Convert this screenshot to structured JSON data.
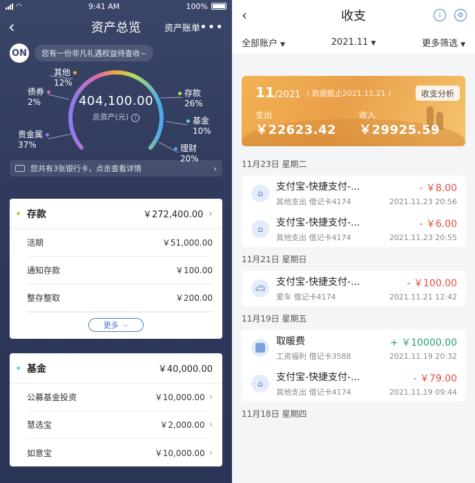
{
  "left": {
    "status": {
      "time": "9:41 AM",
      "battery": "100%"
    },
    "nav": {
      "title": "资产总览",
      "account_link": "资产账单",
      "more": "•••",
      "back": "‹"
    },
    "promo": {
      "text": "您有一份非凡礼遇权益待查收~",
      "mascot": "ON"
    },
    "gauge": {
      "total": "404,100.00",
      "subtitle": "总资产(元)",
      "info": "i",
      "categories": [
        {
          "name": "其他",
          "pct": "12%",
          "color": "#f3a73e"
        },
        {
          "name": "债券",
          "pct": "2%",
          "color": "#e06aa8"
        },
        {
          "name": "贵金属",
          "pct": "37%",
          "color": "#8a7cf0"
        },
        {
          "name": "存款",
          "pct": "26%",
          "color": "#b8e05a"
        },
        {
          "name": "基金",
          "pct": "10%",
          "color": "#5fd7e0"
        },
        {
          "name": "理财",
          "pct": "20%",
          "color": "#4aa6f0"
        }
      ]
    },
    "cards_bar": "您共有3张银行卡，点击查看详情",
    "deposit": {
      "title": "存款",
      "amount": "￥272,400.00",
      "dot": "#b8d34a",
      "rows": [
        {
          "label": "活期",
          "amount": "￥51,000.00"
        },
        {
          "label": "通知存款",
          "amount": "￥100.00"
        },
        {
          "label": "整存整取",
          "amount": "￥200.00"
        }
      ],
      "more": "更多"
    },
    "fund": {
      "title": "基金",
      "amount": "￥40,000.00",
      "dot": "#5fd7e0",
      "rows": [
        {
          "label": "公募基金投资",
          "amount": "￥10,000.00"
        },
        {
          "label": "慧选宝",
          "amount": "￥2,000.00"
        },
        {
          "label": "如意宝",
          "amount": "￥10,000.00"
        }
      ]
    }
  },
  "right": {
    "nav": {
      "title": "收支",
      "back": "‹",
      "info_icon": "i",
      "settings_icon": "⚙"
    },
    "filters": {
      "account": "全部账户",
      "month": "2021.11",
      "more": "更多筛选"
    },
    "summary": {
      "month_big": "11",
      "month_small": "/2021",
      "note": "( 数据截止2021.11.21 )",
      "analysis": "收支分析",
      "expense_label": "支出",
      "expense": "￥22623.42",
      "income_label": "收入",
      "income": "￥29925.59"
    },
    "groups": [
      {
        "date": "11月23日  星期二",
        "items": [
          {
            "name": "支付宝-快捷支付-...",
            "sub": "其他支出  借记卡4174",
            "amount": "- ￥8.00",
            "type": "neg",
            "time": "2021.11.23  20:56",
            "icon": "home"
          },
          {
            "name": "支付宝-快捷支付-...",
            "sub": "其他支出  借记卡4174",
            "amount": "- ￥6.00",
            "type": "neg",
            "time": "2021.11.23  20:55",
            "icon": "home"
          }
        ]
      },
      {
        "date": "11月21日  星期日",
        "items": [
          {
            "name": "支付宝-快捷支付-...",
            "sub": "爱车  借记卡4174",
            "amount": "- ￥100.00",
            "type": "neg",
            "time": "2021.11.21  12:42",
            "icon": "car"
          }
        ]
      },
      {
        "date": "11月19日  星期五",
        "items": [
          {
            "name": "取暖费",
            "sub": "工资福利  借记卡3588",
            "amount": "+ ￥10000.00",
            "type": "pos",
            "time": "2021.11.19  20:32",
            "icon": "wallet"
          },
          {
            "name": "支付宝-快捷支付-...",
            "sub": "其他支出  借记卡4174",
            "amount": "- ￥79.00",
            "type": "neg",
            "time": "2021.11.19  09:44",
            "icon": "home"
          }
        ]
      },
      {
        "date": "11月18日  星期四",
        "items": []
      }
    ]
  }
}
